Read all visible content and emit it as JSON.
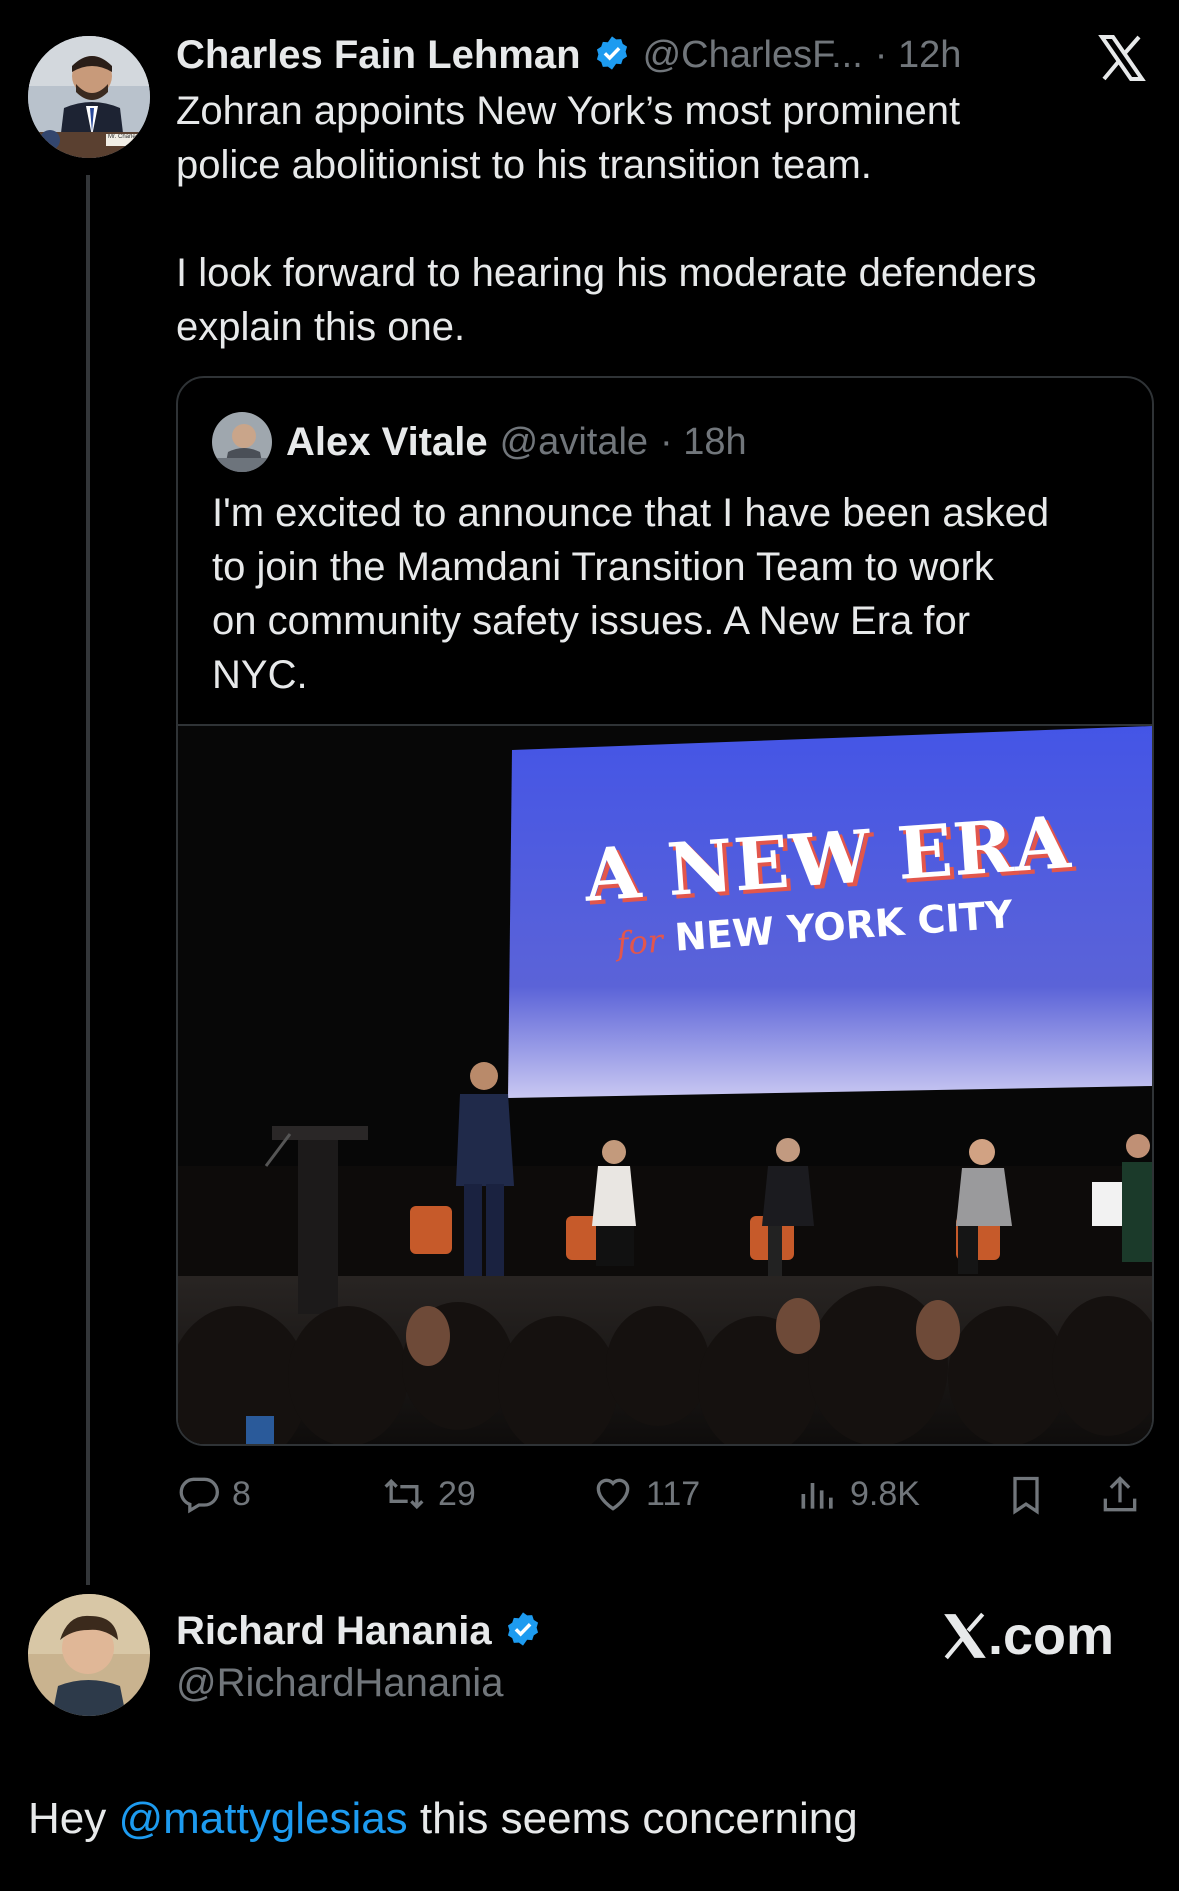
{
  "tweet": {
    "author_name": "Charles Fain Lehman",
    "author_handle": "@CharlesF...",
    "time": "· 12h",
    "text_line1": "Zohran appoints New York’s most prominent",
    "text_line2": "police abolitionist to his transition team.",
    "text_line3": "I look forward to hearing his moderate defenders",
    "text_line4": "explain this one.",
    "avatar_nameplate": "Mr. Charles"
  },
  "quote": {
    "author_name": "Alex Vitale",
    "author_handle": "@avitale",
    "time": "· 18h",
    "text_line1": "I'm excited to announce that I have been asked",
    "text_line2": "to join the Mamdani Transition Team to work",
    "text_line3": "on community safety issues. A New Era for",
    "text_line4": "NYC.",
    "image": {
      "screen_title": "A NEW ERA",
      "screen_for": "for",
      "screen_subtitle": "NEW YORK CITY"
    }
  },
  "actions": {
    "replies": "8",
    "reposts": "29",
    "likes": "117",
    "views": "9.8K"
  },
  "footer": {
    "author_name": "Richard Hanania",
    "author_handle": "@RichardHanania",
    "site": "X.com",
    "text_prefix": "Hey ",
    "mention": "@mattyglesias",
    "text_suffix": " this seems concerning"
  },
  "colors": {
    "background": "#000000",
    "text": "#e7e9ea",
    "muted": "#71767b",
    "verified": "#1d9bf0",
    "mention": "#1d9bf0",
    "screen_blue": "#4a5be0"
  }
}
